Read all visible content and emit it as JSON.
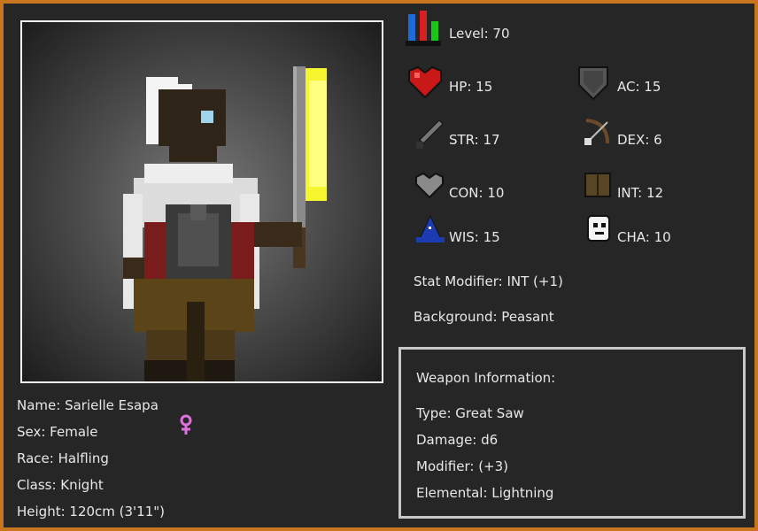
{
  "character": {
    "level": "Level: 70",
    "stats": {
      "hp": "HP: 15",
      "ac": "AC: 15",
      "str": "STR: 17",
      "dex": "DEX: 6",
      "con": "CON: 10",
      "int": "INT: 12",
      "wis": "WIS: 15",
      "cha": "CHA: 10"
    },
    "stat_modifier": "Stat Modifier: INT (+1)",
    "background": "Background: Peasant",
    "name": "Name: Sarielle Esapa",
    "sex": "Sex: Female",
    "race": "Race: Halfling",
    "class": "Class: Knight",
    "height": "Height: 120cm (3'11\")"
  },
  "weapon": {
    "header": "Weapon Information:",
    "type": "Type: Great Saw",
    "damage": "Damage: d6",
    "modifier": "Modifier: (+3)",
    "elemental": "Elemental: Lightning"
  },
  "icons": {
    "level": "level-bars-icon",
    "hp": "heart-icon",
    "ac": "shield-icon",
    "str": "sword-icon",
    "dex": "bow-icon",
    "con": "grey-heart-icon",
    "int": "book-icon",
    "wis": "wizard-hat-icon",
    "cha": "mask-icon",
    "sex": "female-symbol-icon"
  },
  "colors": {
    "frame_border": "#c8751e",
    "background": "#262626",
    "female_symbol": "#e070e0",
    "blade_glow": "#ffff60"
  }
}
